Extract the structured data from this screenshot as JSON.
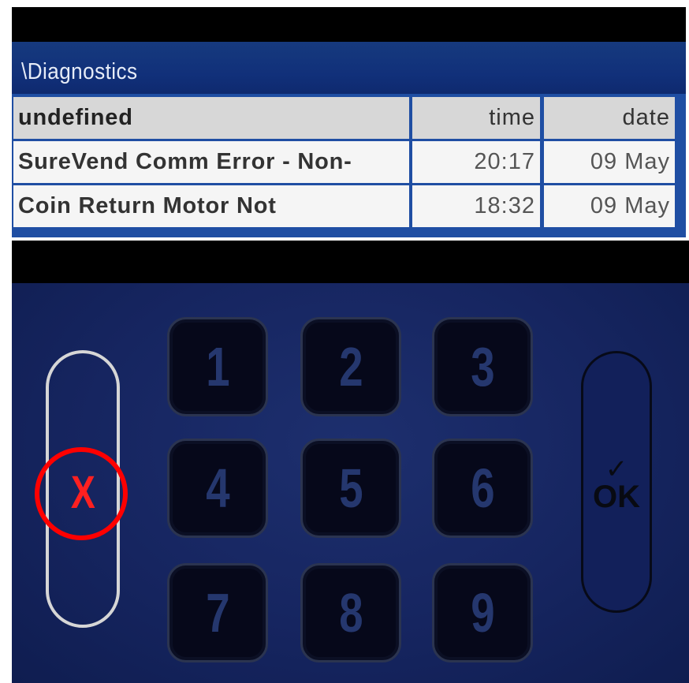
{
  "header": {
    "title": "\\Diagnostics"
  },
  "table": {
    "columns": [
      "undefined",
      "time",
      "date"
    ],
    "rows": [
      {
        "event": "SureVend Comm Error - Non-",
        "time": "20:17",
        "date": "09 May"
      },
      {
        "event": "Coin Return Motor Not",
        "time": "18:32",
        "date": "09 May"
      }
    ]
  },
  "keypad": {
    "keys": [
      "1",
      "2",
      "3",
      "4",
      "5",
      "6",
      "7",
      "8",
      "9"
    ],
    "cancel_label": "X",
    "ok_check": "✓",
    "ok_label": "OK"
  },
  "colors": {
    "title_bar": "#11307a",
    "table_border": "#1f4ea3",
    "keypad_bg": "#162560",
    "cancel_x": "#ff2020",
    "highlight_ring": "#ff0000"
  }
}
